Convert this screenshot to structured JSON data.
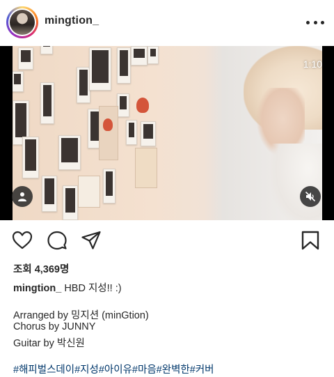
{
  "header": {
    "username": "mingtion_"
  },
  "video": {
    "timestamp": "1:10"
  },
  "stats": {
    "views": "조회 4,369명"
  },
  "caption": {
    "username": "mingtion_",
    "text": "HBD 지성!! :)",
    "lines": [
      "Arranged by 밍지션 (minGtion)",
      "Chorus by JUNNY",
      "Guitar by 박신원"
    ],
    "hashtags": "#해피벌스데이#지성#아이유#마음#완벽한#커버"
  },
  "icons": {
    "more": "more-options-icon",
    "user_tag": "user-tag-icon",
    "mute": "muted-speaker-icon",
    "like": "heart-icon",
    "comment": "comment-bubble-icon",
    "share": "paper-plane-icon",
    "save": "bookmark-icon"
  },
  "colors": {
    "text": "#262626",
    "hashtag": "#00376b",
    "overlay_button": "#282828"
  }
}
